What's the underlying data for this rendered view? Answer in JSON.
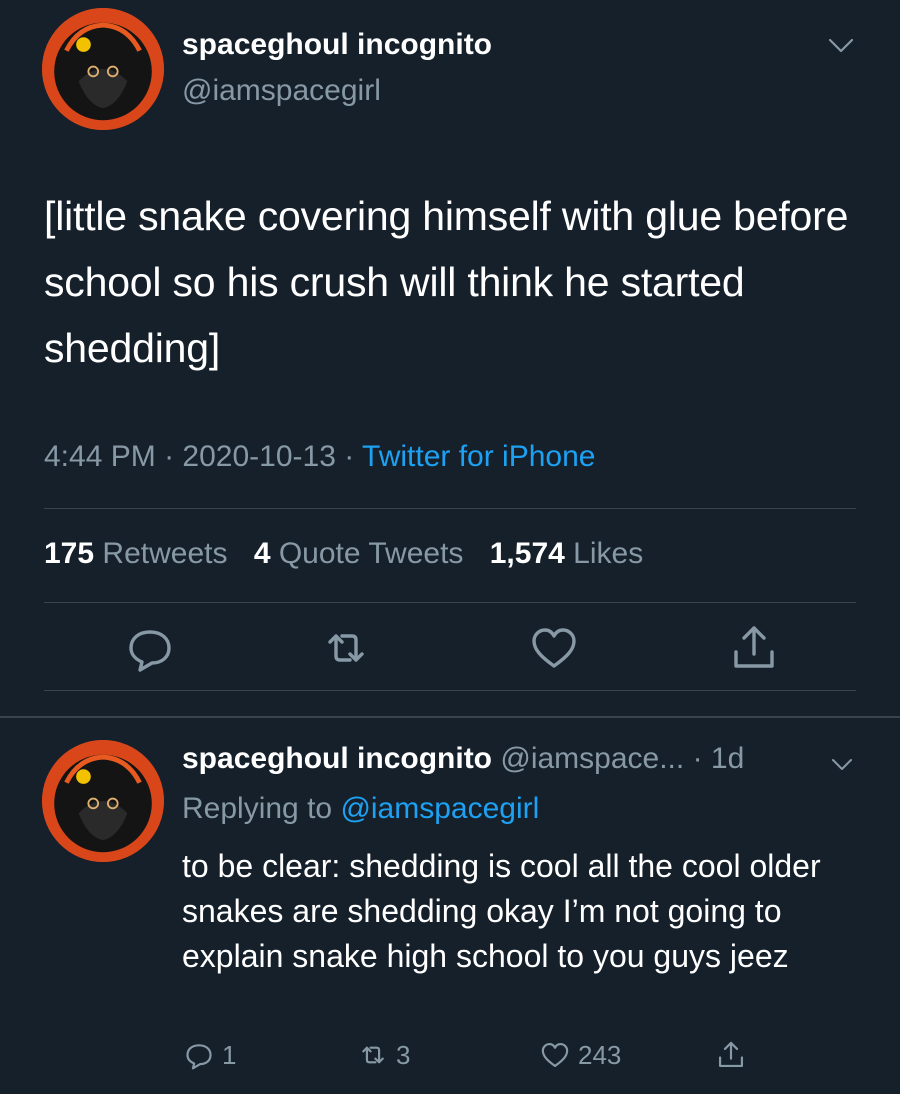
{
  "main_tweet": {
    "display_name": "spaceghoul incognito",
    "handle": "@iamspacegirl",
    "text": "[little snake covering himself with glue before school so his crush will think he started shedding]",
    "time": "4:44 PM",
    "date": "2020-10-13",
    "separator": "·",
    "source": "Twitter for iPhone",
    "stats": {
      "retweets_count": "175",
      "retweets_label": "Retweets",
      "quotes_count": "4",
      "quotes_label": "Quote Tweets",
      "likes_count": "1,574",
      "likes_label": "Likes"
    },
    "icons": [
      "reply-icon",
      "retweet-icon",
      "like-icon",
      "share-icon"
    ]
  },
  "reply_tweet": {
    "display_name": "spaceghoul incognito",
    "handle": "@iamspace...",
    "age": "· 1d",
    "replying_prefix": "Replying to",
    "replying_to": "@iamspacegirl",
    "text": "to be clear: shedding is cool all the cool older snakes are shedding okay I’m not going to explain snake high school to you guys jeez",
    "reply_count": "1",
    "retweet_count": "3",
    "like_count": "243"
  },
  "colors": {
    "background": "#15202b",
    "muted": "#8899a6",
    "link": "#1da1f2",
    "divider": "#38444d"
  }
}
